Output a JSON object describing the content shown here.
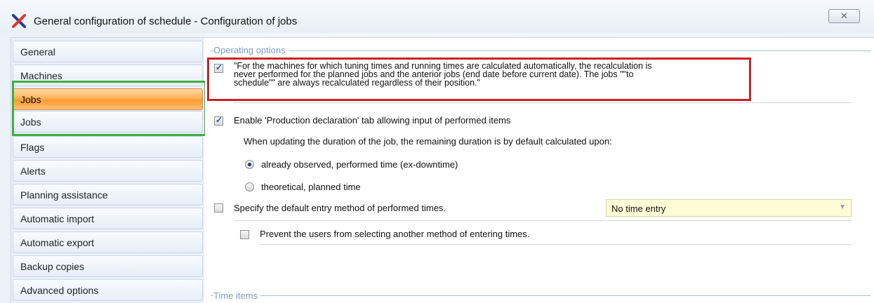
{
  "window": {
    "title": "General configuration of schedule - Configuration of jobs",
    "close_glyph": "✕",
    "app_icon": "x-logo-icon"
  },
  "sidebar": {
    "items": [
      {
        "label": "General",
        "active": false
      },
      {
        "label": "Machines",
        "active": false
      },
      {
        "label": "Jobs",
        "active": true
      },
      {
        "label": "Jobs",
        "active": false
      },
      {
        "label": "Flags",
        "active": false
      },
      {
        "label": "Alerts",
        "active": false
      },
      {
        "label": "Planning assistance",
        "active": false
      },
      {
        "label": "Automatic import",
        "active": false
      },
      {
        "label": "Automatic export",
        "active": false
      },
      {
        "label": "Backup copies",
        "active": false
      },
      {
        "label": "Advanced options",
        "active": false
      }
    ]
  },
  "operating_options": {
    "group_title": "Operating options",
    "recalc": {
      "checked": true,
      "text": "\"For the machines for which tuning times and running times are calculated automatically, the recalculation is\nnever performed for the planned jobs and the anterior jobs (end date before current date). The jobs \"\"to\nschedule\"\" are always recalculated regardless of their position.\""
    },
    "production_declaration": {
      "checked": true,
      "label": "Enable 'Production declaration' tab allowing input of performed items"
    },
    "duration_hint": "When updating the duration of the job, the remaining duration is by default calculated upon:",
    "radio_options": [
      {
        "label": "already observed, performed time (ex-downtime)",
        "selected": true
      },
      {
        "label": "theoretical, planned time",
        "selected": false
      }
    ],
    "entry_method": {
      "checked": false,
      "label": "Specify the default entry method of performed times.",
      "select_value": "No time entry"
    },
    "prevent_users": {
      "checked": false,
      "label": "Prevent the users from selecting another method of entering times."
    }
  },
  "time_items": {
    "group_title": "Time items"
  },
  "colors": {
    "highlight_red": "#cc2127",
    "highlight_green": "#3fb03f",
    "active_tab": "#ff9a2e",
    "group_title": "#7d9bc4"
  }
}
